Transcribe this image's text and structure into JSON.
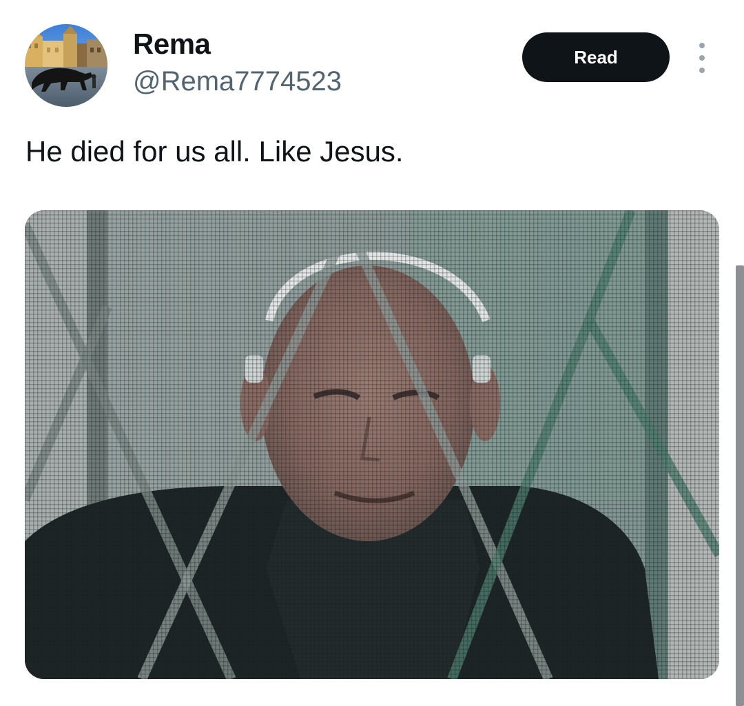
{
  "post": {
    "author": {
      "display_name": "Rema",
      "handle": "@Rema7774523",
      "avatar": "profile-photo"
    },
    "read_button_label": "Read",
    "more_icon": "more-vertical-icon",
    "text": "He died for us all. Like Jesus.",
    "media": "photo"
  },
  "colors": {
    "button_bg": "#0f1419",
    "text_primary": "#0f1419",
    "text_secondary": "#536471"
  }
}
